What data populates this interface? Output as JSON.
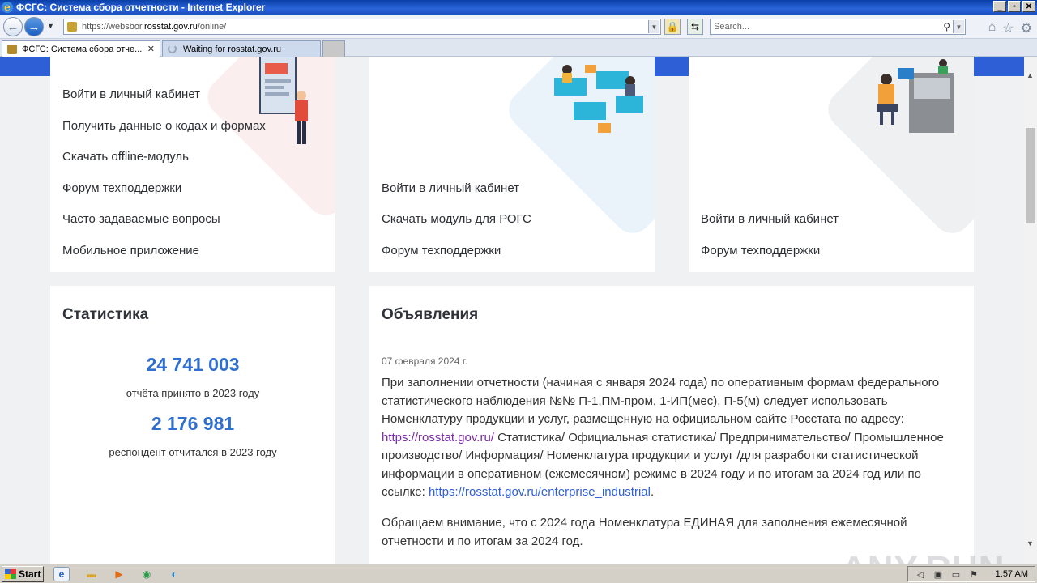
{
  "browser": {
    "title": "ФСГС: Система сбора отчетности - Internet Explorer",
    "url_prefix": "https://websbor.",
    "url_domain": "rosstat.gov.ru",
    "url_path": "/online/",
    "search_placeholder": "Search...",
    "tabs": [
      {
        "label": "ФСГС: Система сбора отче..."
      },
      {
        "label": "Waiting for rosstat.gov.ru"
      }
    ]
  },
  "cards": {
    "card1": {
      "links": [
        "Войти в личный кабинет",
        "Получить данные о кодах и формах",
        "Скачать offline-модуль",
        "Форум техподдержки",
        "Часто задаваемые вопросы",
        "Мобильное приложение"
      ]
    },
    "card2": {
      "links": [
        "Войти в личный кабинет",
        "Скачать модуль для РОГС",
        "Форум техподдержки"
      ]
    },
    "card3": {
      "links": [
        "Войти в личный кабинет",
        "Форум техподдержки"
      ]
    }
  },
  "stats": {
    "title": "Статистика",
    "value1": "24 741 003",
    "caption1": "отчёта принято в 2023 году",
    "value2": "2 176 981",
    "caption2": "респондент отчитался в 2023 году"
  },
  "announcements": {
    "title": "Объявления",
    "date": "07 февраля 2024 г.",
    "p1_part1": "При заполнении отчетности (начиная с января 2024 года) по оперативным формам федерального статистического наблюдения №№ П-1,ПМ-пром, 1-ИП(мес), П-5(м) следует использовать Номенклатуру продукции и услуг, размещенную на официальном сайте Росстата по адресу: ",
    "p1_link1": "https://rosstat.gov.ru/",
    "p1_part2": " Статистика/ Официальная статистика/ Предпринимательство/ Промышленное производство/ Информация/ Номенклатура продукции и услуг /для разработки статистической информации в оперативном (ежемесячном) режиме в 2024 году и по итогам за 2024 год или по ссылке: ",
    "p1_link2": "https://rosstat.gov.ru/enterprise_industrial",
    "p1_part3": ".",
    "p2": "Обращаем внимание, что с 2024 года Номенклатура ЕДИНАЯ для заполнения ежемесячной отчетности и по итогам за 2024 год."
  },
  "watermark": "ANY.RUN",
  "taskbar": {
    "start_label": "Start",
    "clock": "1:57 AM"
  },
  "colors": {
    "accent": "#2f5fd7",
    "number": "#2f6fd0",
    "visited_link": "#7b2aa8"
  }
}
